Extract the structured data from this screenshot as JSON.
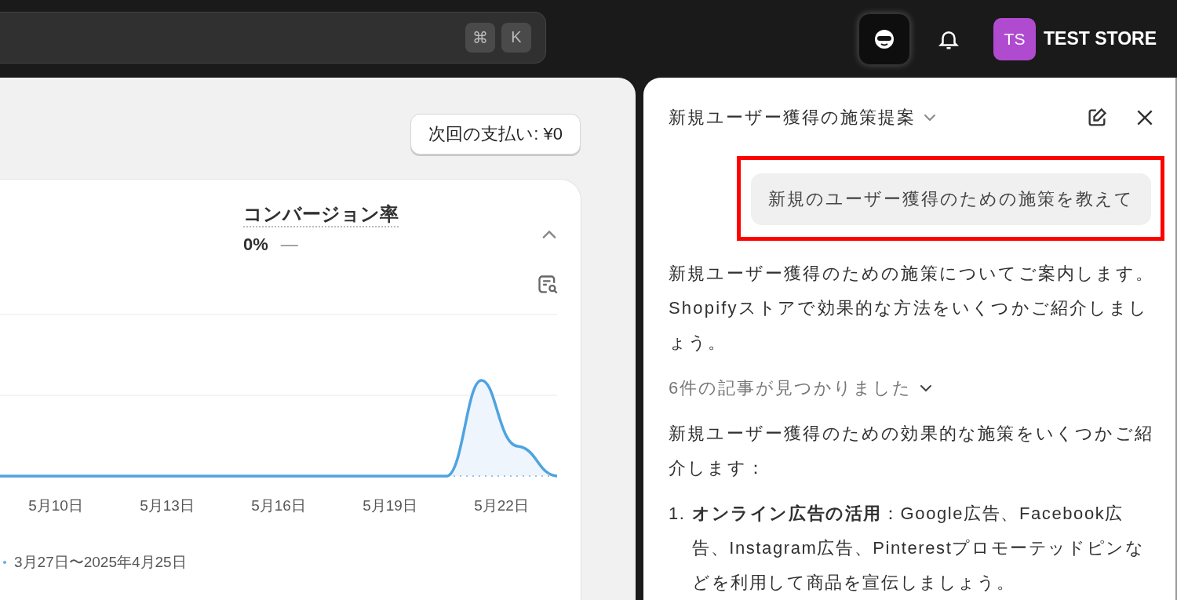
{
  "topbar": {
    "search_keys": [
      "⌘",
      "K"
    ],
    "store": {
      "initials": "TS",
      "name": "TEST STORE"
    }
  },
  "dashboard": {
    "payment_button": "次回の支払い: ¥0",
    "metric": {
      "title": "コンバージョン率",
      "value": "0%",
      "change": "—",
      "expanded": true
    },
    "chart": {
      "x_labels": [
        "5月10日",
        "5月13日",
        "5月16日",
        "5月19日",
        "5月22日"
      ],
      "legend": "3月27日〜2025年4月25日"
    }
  },
  "chat": {
    "title": "新規ユーザー獲得の施策提案",
    "messages": [
      {
        "kind": "user",
        "text": "新規のユーザー獲得のための施策を教えて",
        "highlighted": true
      },
      {
        "kind": "assistant",
        "text": "新規ユーザー獲得のための施策についてご案内します。Shopifyストアで効果的な方法をいくつかご紹介しましょう。"
      },
      {
        "kind": "sources",
        "text": "6件の記事が見つかりました",
        "expanded": false
      },
      {
        "kind": "assistant",
        "text": "新規ユーザー獲得のための効果的な施策をいくつかご紹介します："
      },
      {
        "kind": "list_item",
        "number": "1.",
        "text": "**オンライン広告の活用**：Google広告、Facebook広告、Instagram広告、Pinterestプロモーテッドピンなどを利用して商品を宣伝しましょう。"
      }
    ]
  }
}
